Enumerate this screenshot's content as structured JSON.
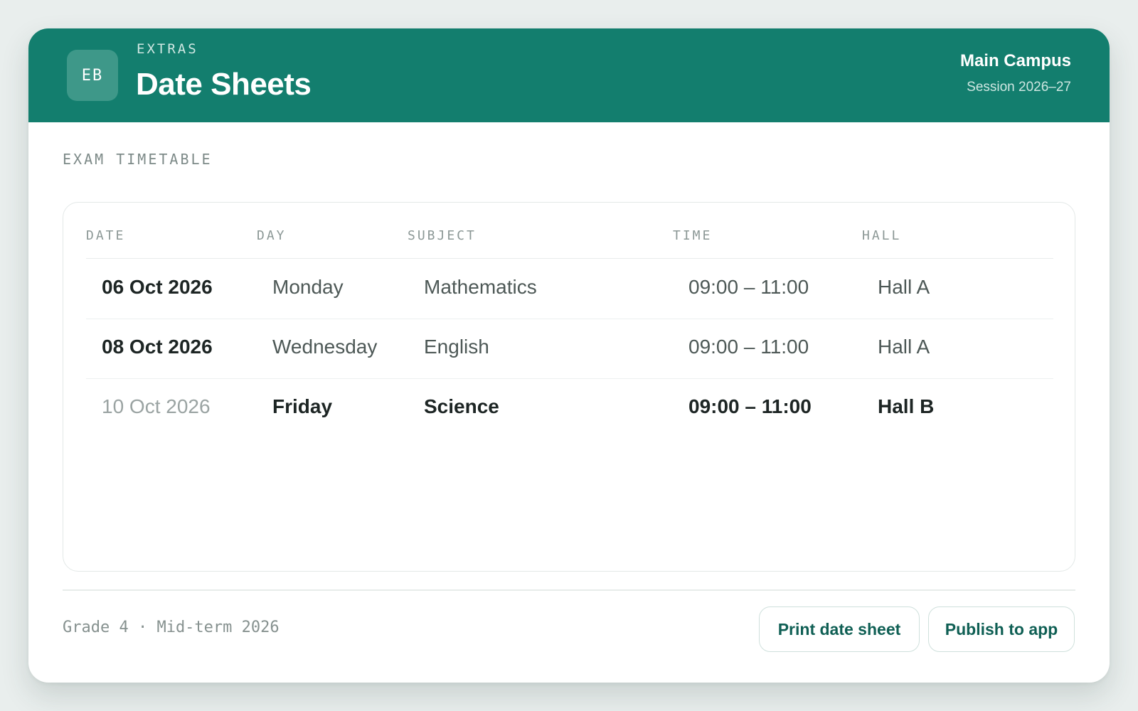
{
  "header": {
    "logo_initials": "EB",
    "eyebrow": "EXTRAS",
    "title": "Date Sheets",
    "campus": "Main Campus",
    "session": "Session 2026–27"
  },
  "section": {
    "label": "EXAM TIMETABLE"
  },
  "table": {
    "columns": [
      "DATE",
      "DAY",
      "SUBJECT",
      "TIME",
      "HALL"
    ],
    "rows": [
      {
        "date": "06 Oct 2026",
        "day": "Monday",
        "subject": "Mathematics",
        "time": "09:00 – 11:00",
        "hall": "Hall A"
      },
      {
        "date": "08 Oct 2026",
        "day": "Wednesday",
        "subject": "English",
        "time": "09:00 – 11:00",
        "hall": "Hall A"
      },
      {
        "date": "10 Oct 2026",
        "day": "Friday",
        "subject": "Science",
        "time": "09:00 – 11:00",
        "hall": "Hall B"
      }
    ]
  },
  "footer": {
    "note": "Grade 4 · Mid-term 2026",
    "print_label": "Print date sheet",
    "publish_label": "Publish to app"
  },
  "colors": {
    "header_bg": "#137e6e",
    "accent_text": "#0f5f54",
    "page_bg": "#e9eeed"
  }
}
